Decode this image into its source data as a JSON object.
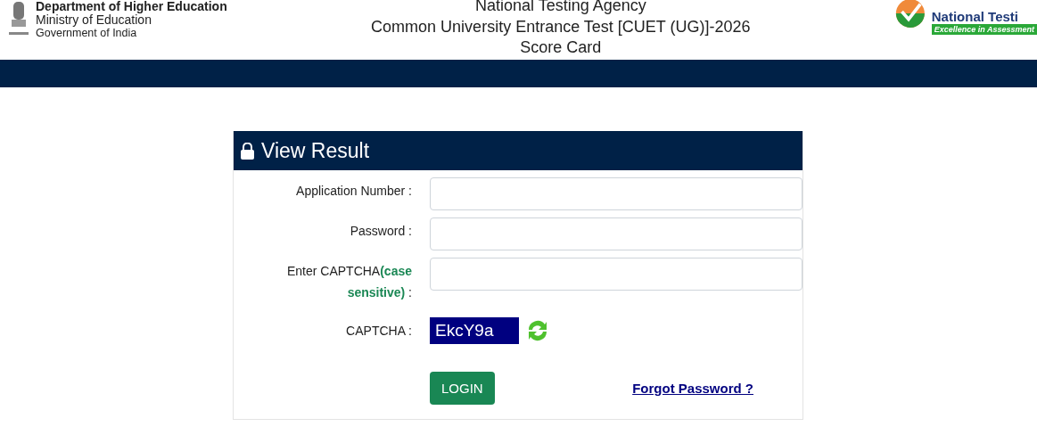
{
  "header": {
    "department": "Department of Higher Education",
    "ministry": "Ministry of Education",
    "government": "Government of India",
    "title_lines": [
      "National Testing Agency",
      "Common University Entrance Test [CUET (UG)]-2026",
      "Score Card"
    ],
    "logo_name": "National Testi",
    "logo_tagline": "Excellence in Assessment"
  },
  "card": {
    "title": "View Result",
    "fields": [
      {
        "kind": "input",
        "label": "Application Number :"
      },
      {
        "kind": "input",
        "label": "Password :"
      },
      {
        "kind": "input",
        "label": "Enter CAPTCHA**(case sensitive)** :"
      },
      {
        "kind": "captcha",
        "label": "CAPTCHA :",
        "value": "EkcY9a"
      }
    ],
    "login_button": "LOGIN",
    "forgot_link": "Forgot Password ?"
  }
}
